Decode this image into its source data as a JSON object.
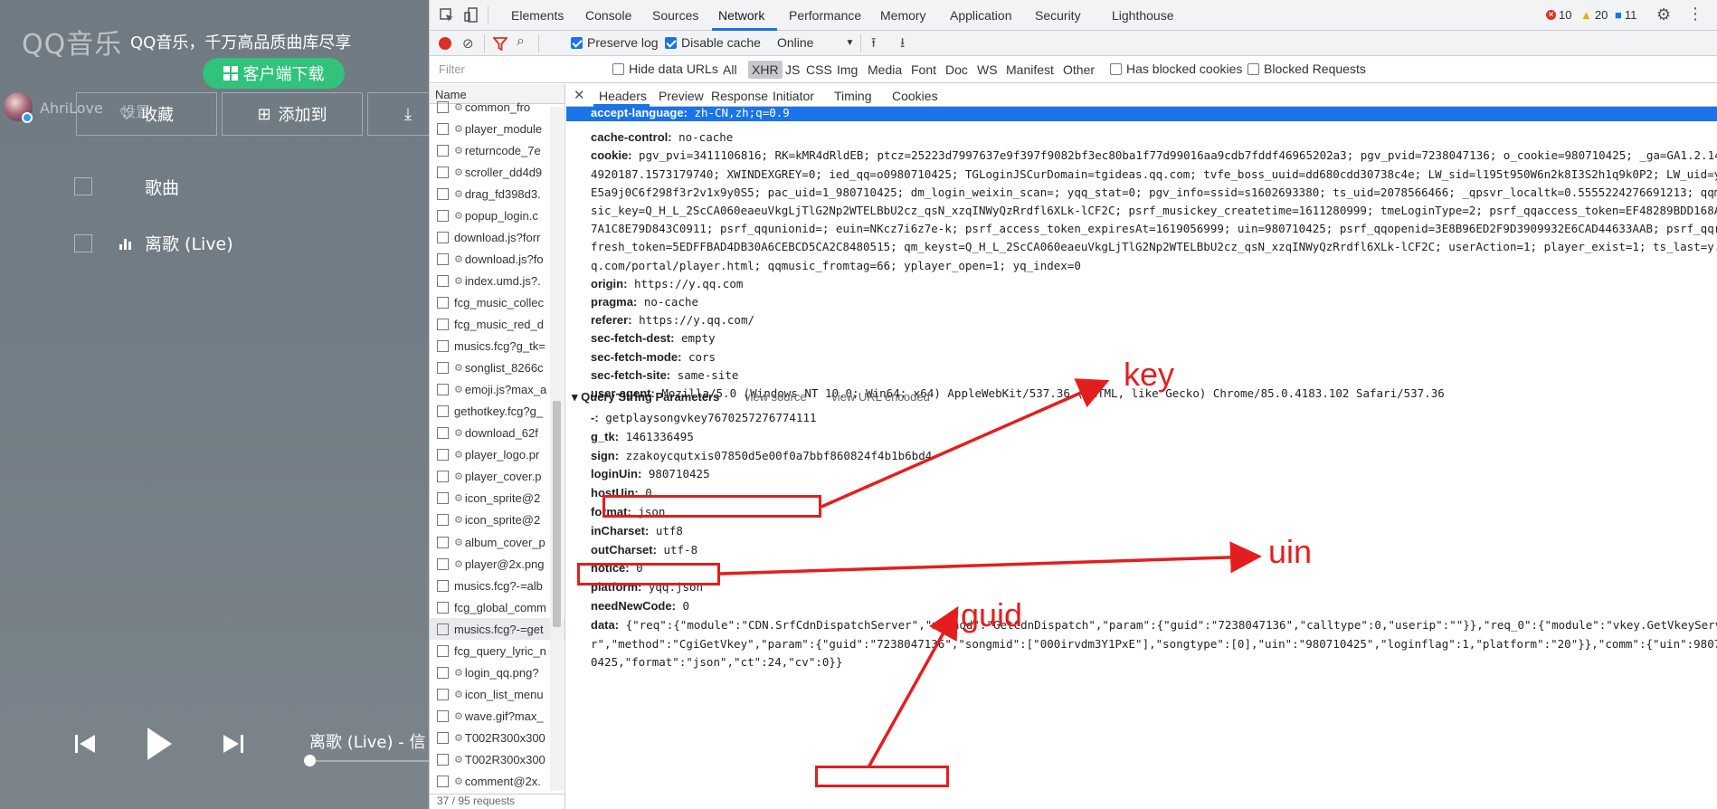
{
  "player": {
    "logo": "QQ音乐",
    "slogan": "QQ音乐，千万高品质曲库尽享",
    "download_btn": "客户端下载",
    "username": "AhriLove",
    "settings": "设置",
    "actions": {
      "collect": "收藏",
      "add_to": "添加到"
    },
    "list_header": "歌曲",
    "song_title": "离歌 (Live)",
    "now_playing": "离歌 (Live) - 信"
  },
  "devtools": {
    "tabs": [
      "Elements",
      "Console",
      "Sources",
      "Network",
      "Performance",
      "Memory",
      "Application",
      "Security",
      "Lighthouse"
    ],
    "active_tab": "Network",
    "counts": {
      "errors": "10",
      "warnings": "20",
      "info": "11"
    },
    "toolbar": {
      "preserve_log": "Preserve log",
      "disable_cache": "Disable cache",
      "throttle": "Online"
    },
    "filter": {
      "placeholder": "Filter",
      "hide_data_urls": "Hide data URLs",
      "types": [
        "All",
        "XHR",
        "JS",
        "CSS",
        "Img",
        "Media",
        "Font",
        "Doc",
        "WS",
        "Manifest",
        "Other"
      ],
      "active_type": "XHR",
      "has_blocked_cookies": "Has blocked cookies",
      "blocked_requests": "Blocked Requests"
    },
    "name_header": "Name",
    "requests": [
      {
        "name": "common_fro",
        "gear": true
      },
      {
        "name": "player_module",
        "gear": true
      },
      {
        "name": "returncode_7e",
        "gear": true
      },
      {
        "name": "scroller_dd4d9",
        "gear": true
      },
      {
        "name": "drag_fd398d3.",
        "gear": true
      },
      {
        "name": "popup_login.c",
        "gear": true
      },
      {
        "name": "download.js?forr",
        "gear": false
      },
      {
        "name": "download.js?fo",
        "gear": true
      },
      {
        "name": "index.umd.js?.",
        "gear": true
      },
      {
        "name": "fcg_music_collec",
        "gear": false
      },
      {
        "name": "fcg_music_red_d",
        "gear": false
      },
      {
        "name": "musics.fcg?g_tk=",
        "gear": false
      },
      {
        "name": "songlist_8266c",
        "gear": true
      },
      {
        "name": "emoji.js?max_a",
        "gear": true
      },
      {
        "name": "gethotkey.fcg?g_",
        "gear": false
      },
      {
        "name": "download_62f",
        "gear": true
      },
      {
        "name": "player_logo.pr",
        "gear": true
      },
      {
        "name": "player_cover.p",
        "gear": true
      },
      {
        "name": "icon_sprite@2",
        "gear": true
      },
      {
        "name": "icon_sprite@2",
        "gear": true
      },
      {
        "name": "album_cover_p",
        "gear": true
      },
      {
        "name": "player@2x.png",
        "gear": true
      },
      {
        "name": "musics.fcg?-=alb",
        "gear": false
      },
      {
        "name": "fcg_global_comm",
        "gear": false
      },
      {
        "name": "musics.fcg?-=get",
        "gear": false
      },
      {
        "name": "fcg_query_lyric_n",
        "gear": false
      },
      {
        "name": "login_qq.png?",
        "gear": true
      },
      {
        "name": "icon_list_menu",
        "gear": true
      },
      {
        "name": "wave.gif?max_",
        "gear": true
      },
      {
        "name": "T002R300x300",
        "gear": true
      },
      {
        "name": "T002R300x300",
        "gear": true
      },
      {
        "name": "comment@2x.",
        "gear": true
      }
    ],
    "footer": "37 / 95 requests",
    "detail_tabs": [
      "Headers",
      "Preview",
      "Response",
      "Initiator",
      "Timing",
      "Cookies"
    ],
    "headers": [
      {
        "k": "accept-language:",
        "v": "zh-CN,zh;q=0.9"
      },
      {
        "k": "cache-control:",
        "v": "no-cache"
      },
      {
        "k": "cookie:",
        "v": "pgv_pvi=3411106816; RK=kMR4dRldEB; ptcz=25223d7997637e9f397f9082bf3ec80ba1f77d99016aa9cdb7fddf46965202a3; pgv_pvid=7238047136; o_cookie=980710425; _ga=GA1.2.141"
      },
      {
        "k": "",
        "v": "4920187.1573179740; XWINDEXGREY=0; ied_qq=o0980710425; TGLoginJSCurDomain=tgideas.qq.com; tvfe_boss_uuid=dd680cdd30738c4e; LW_sid=l195t950W6n2k8I3S2h1q9k0P2; LW_uid=y1"
      },
      {
        "k": "",
        "v": "E5a9j0C6f298f3r2v1x9y0S5; pac_uid=1_980710425; dm_login_weixin_scan=; yqq_stat=0; pgv_info=ssid=s1602693380; ts_uid=2078566466; _qpsvr_localtk=0.5555224276691213; qqmu"
      },
      {
        "k": "",
        "v": "sic_key=Q_H_L_2ScCA060eaeuVkgLjTlG2Np2WTELBbU2cz_qsN_xzqINWyQzRrdfl6XLk-lCF2C; psrf_musickey_createtime=1611280999; tmeLoginType=2; psrf_qqaccess_token=EF48289BDD168AF"
      },
      {
        "k": "",
        "v": "7A1C8E79D843C0911; psrf_qqunionid=; euin=NKcz7i6z7e-k; psrf_access_token_expiresAt=1619056999; uin=980710425; psrf_qqopenid=3E8B96ED2F9D3909932E6CAD44633AAB; psrf_qqre"
      },
      {
        "k": "",
        "v": "fresh_token=5EDFFBAD4DB30A6CEBCD5CA2C8480515; qm_keyst=Q_H_L_2ScCA060eaeuVkgLjTlG2Np2WTELBbU2cz_qsN_xzqINWyQzRrdfl6XLk-lCF2C; userAction=1; player_exist=1; ts_last=y.q"
      },
      {
        "k": "",
        "v": "q.com/portal/player.html; qqmusic_fromtag=66; yplayer_open=1; yq_index=0"
      },
      {
        "k": "origin:",
        "v": "https://y.qq.com"
      },
      {
        "k": "pragma:",
        "v": "no-cache"
      },
      {
        "k": "referer:",
        "v": "https://y.qq.com/"
      },
      {
        "k": "sec-fetch-dest:",
        "v": "empty"
      },
      {
        "k": "sec-fetch-mode:",
        "v": "cors"
      },
      {
        "k": "sec-fetch-site:",
        "v": "same-site"
      },
      {
        "k": "user-agent:",
        "v": "Mozilla/5.0 (Windows NT 10.0; Win64; x64) AppleWebKit/537.36 (KHTML, like Gecko) Chrome/85.0.4183.102 Safari/537.36"
      }
    ],
    "qs_section": {
      "title": "Query String Parameters",
      "view_source": "view source",
      "view_encoded": "view URL encoded"
    },
    "params": [
      {
        "k": "-:",
        "v": "getplaysongvkey7670257276774111"
      },
      {
        "k": "g_tk:",
        "v": "1461336495"
      },
      {
        "k": "sign:",
        "v": "zzakoycqutxis07850d5e00f0a7bbf860824f4b1b6bd4"
      },
      {
        "k": "loginUin:",
        "v": "980710425"
      },
      {
        "k": "hostUin:",
        "v": "0"
      },
      {
        "k": "format:",
        "v": "json"
      },
      {
        "k": "inCharset:",
        "v": "utf8"
      },
      {
        "k": "outCharset:",
        "v": "utf-8"
      },
      {
        "k": "notice:",
        "v": "0"
      },
      {
        "k": "platform:",
        "v": "yqq.json"
      },
      {
        "k": "needNewCode:",
        "v": "0"
      },
      {
        "k": "data:",
        "v": "{\"req\":{\"module\":\"CDN.SrfCdnDispatchServer\",\"method\":\"GetCdnDispatch\",\"param\":{\"guid\":\"7238047136\",\"calltype\":0,\"userip\":\"\"}},\"req_0\":{\"module\":\"vkey.GetVkeyServe"
      },
      {
        "k": "",
        "v": "r\",\"method\":\"CgiGetVkey\",\"param\":{\"guid\":\"7238047136\",\"songmid\":[\"000irvdm3Y1PxE\"],\"songtype\":[0],\"uin\":\"980710425\",\"loginflag\":1,\"platform\":\"20\"}},\"comm\":{\"uin\":98071"
      },
      {
        "k": "",
        "v": "0425,\"format\":\"json\",\"ct\":24,\"cv\":0}}"
      }
    ]
  },
  "annotations": {
    "key": "key",
    "uin": "uin",
    "guid": "guid"
  },
  "colors": {
    "accent_red": "#e41e1e",
    "devtools_blue": "#1a73e8",
    "qq_green": "#31c27c"
  }
}
